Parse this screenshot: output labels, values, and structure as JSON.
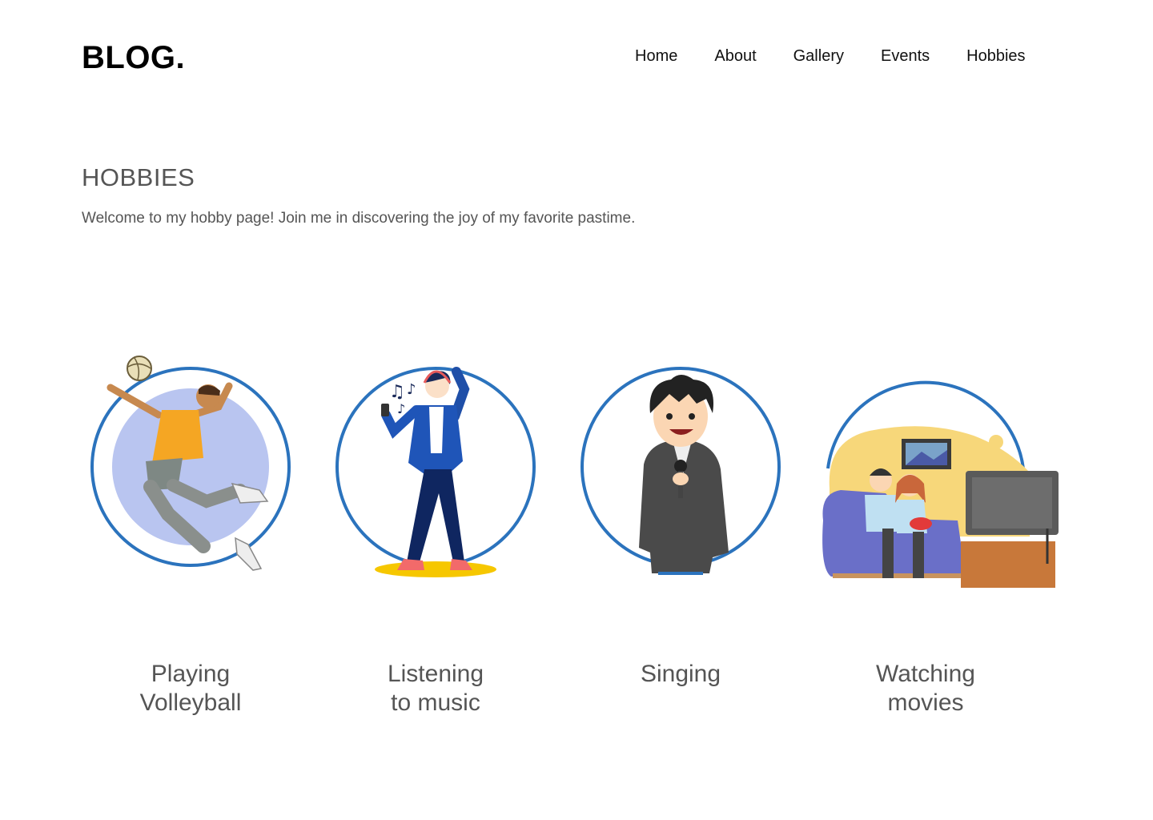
{
  "header": {
    "logo": "BLOG.",
    "nav": [
      "Home",
      "About",
      "Gallery",
      "Events",
      "Hobbies"
    ]
  },
  "main": {
    "title": "HOBBIES",
    "intro": "Welcome to my hobby page! Join me in discovering the joy of my favorite pastime."
  },
  "hobbies": [
    {
      "label_line1": "Playing",
      "label_line2": "Volleyball",
      "icon": "volleyball-player-illustration"
    },
    {
      "label_line1": "Listening",
      "label_line2": "to music",
      "icon": "music-listener-illustration"
    },
    {
      "label_line1": "Singing",
      "label_line2": "",
      "icon": "singer-illustration"
    },
    {
      "label_line1": "Watching",
      "label_line2": "movies",
      "icon": "movie-watching-illustration"
    }
  ],
  "colors": {
    "ring": "#2b73bd",
    "accent_lavender": "#b9c5f0",
    "accent_yellow": "#f6c700",
    "text_gray": "#555555"
  }
}
